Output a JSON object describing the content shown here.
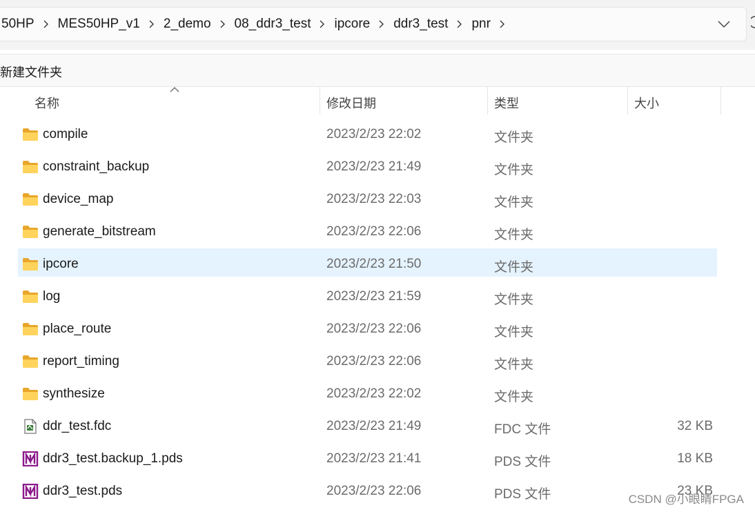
{
  "breadcrumb": [
    "50HP",
    "MES50HP_v1",
    "2_demo",
    "08_ddr3_test",
    "ipcore",
    "ddr3_test",
    "pnr"
  ],
  "toolbar": {
    "new_folder": "新建文件夹"
  },
  "columns": {
    "name": "名称",
    "modified": "修改日期",
    "type": "类型",
    "size": "大小"
  },
  "files": [
    {
      "name": "compile",
      "modified": "2023/2/23 22:02",
      "type": "文件夹",
      "size": "",
      "icon": "folder-icon"
    },
    {
      "name": "constraint_backup",
      "modified": "2023/2/23 21:49",
      "type": "文件夹",
      "size": "",
      "icon": "folder-icon"
    },
    {
      "name": "device_map",
      "modified": "2023/2/23 22:03",
      "type": "文件夹",
      "size": "",
      "icon": "folder-icon"
    },
    {
      "name": "generate_bitstream",
      "modified": "2023/2/23 22:06",
      "type": "文件夹",
      "size": "",
      "icon": "folder-icon"
    },
    {
      "name": "ipcore",
      "modified": "2023/2/23 21:50",
      "type": "文件夹",
      "size": "",
      "icon": "folder-icon",
      "selected": true
    },
    {
      "name": "log",
      "modified": "2023/2/23 21:59",
      "type": "文件夹",
      "size": "",
      "icon": "folder-icon"
    },
    {
      "name": "place_route",
      "modified": "2023/2/23 22:06",
      "type": "文件夹",
      "size": "",
      "icon": "folder-icon"
    },
    {
      "name": "report_timing",
      "modified": "2023/2/23 22:06",
      "type": "文件夹",
      "size": "",
      "icon": "folder-icon"
    },
    {
      "name": "synthesize",
      "modified": "2023/2/23 22:02",
      "type": "文件夹",
      "size": "",
      "icon": "folder-icon"
    },
    {
      "name": "ddr_test.fdc",
      "modified": "2023/2/23 21:49",
      "type": "FDC 文件",
      "size": "32 KB",
      "icon": "fdc-file-icon"
    },
    {
      "name": "ddr3_test.backup_1.pds",
      "modified": "2023/2/23 21:41",
      "type": "PDS 文件",
      "size": "18 KB",
      "icon": "pds-file-icon"
    },
    {
      "name": "ddr3_test.pds",
      "modified": "2023/2/23 22:06",
      "type": "PDS 文件",
      "size": "23 KB",
      "icon": "pds-file-icon"
    }
  ],
  "watermark": "CSDN @小眼睛FPGA",
  "colors": {
    "selection": "#e5f3ff",
    "folder": "#ffc83d",
    "pds_brand": "#8b1a8b"
  }
}
